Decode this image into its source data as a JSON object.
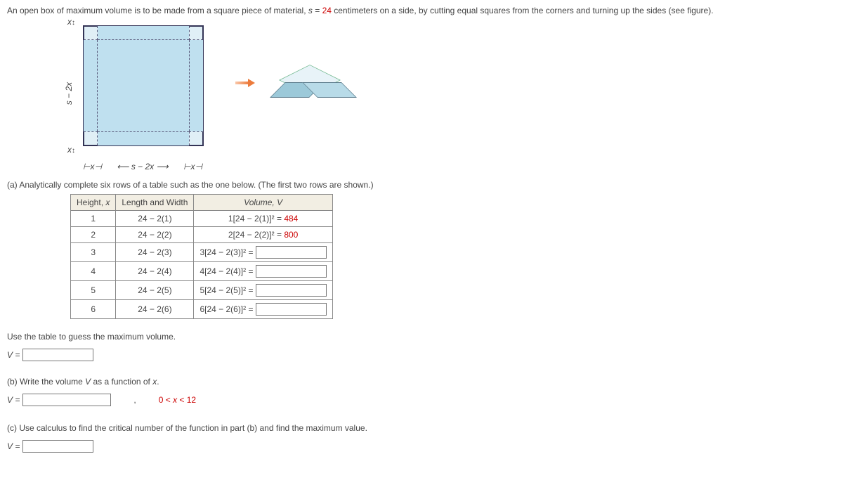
{
  "problem": {
    "intro_pre": "An open box of maximum volume is to be made from a square piece of material, ",
    "s_var": "s",
    "equals": " = ",
    "s_value": "24",
    "intro_post": " centimeters on a side, by cutting equal squares from the corners and turning up the sides (see figure)."
  },
  "figure": {
    "x": "x",
    "side_label": "s − 2x",
    "vertical_label": "s − 2x"
  },
  "part_a": {
    "prompt": "(a) Analytically complete six rows of a table such as the one below. (The first two rows are shown.)",
    "headers": {
      "h": "Height, x",
      "lw": "Length and Width",
      "v": "Volume, V"
    },
    "rows": [
      {
        "h": "1",
        "lw": "24 − 2(1)",
        "vexpr": "1[24 − 2(1)]² = ",
        "vval": "484",
        "input": false
      },
      {
        "h": "2",
        "lw": "24 − 2(2)",
        "vexpr": "2[24 − 2(2)]² = ",
        "vval": "800",
        "input": false
      },
      {
        "h": "3",
        "lw": "24 − 2(3)",
        "vexpr": "3[24 − 2(3)]² = ",
        "vval": "",
        "input": true
      },
      {
        "h": "4",
        "lw": "24 − 2(4)",
        "vexpr": "4[24 − 2(4)]² = ",
        "vval": "",
        "input": true
      },
      {
        "h": "5",
        "lw": "24 − 2(5)",
        "vexpr": "5[24 − 2(5)]² = ",
        "vval": "",
        "input": true
      },
      {
        "h": "6",
        "lw": "24 − 2(6)",
        "vexpr": "6[24 − 2(6)]² = ",
        "vval": "",
        "input": true
      }
    ],
    "guess_prompt": "Use the table to guess the maximum volume.",
    "V_eq": "V ="
  },
  "part_b": {
    "prompt": "(b) Write the volume V as a function of x.",
    "V_eq": "V =",
    "comma": ",",
    "domain": "0 < x < 12"
  },
  "part_c": {
    "prompt": "(c) Use calculus to find the critical number of the function in part (b) and find the maximum value.",
    "V_eq": "V ="
  }
}
